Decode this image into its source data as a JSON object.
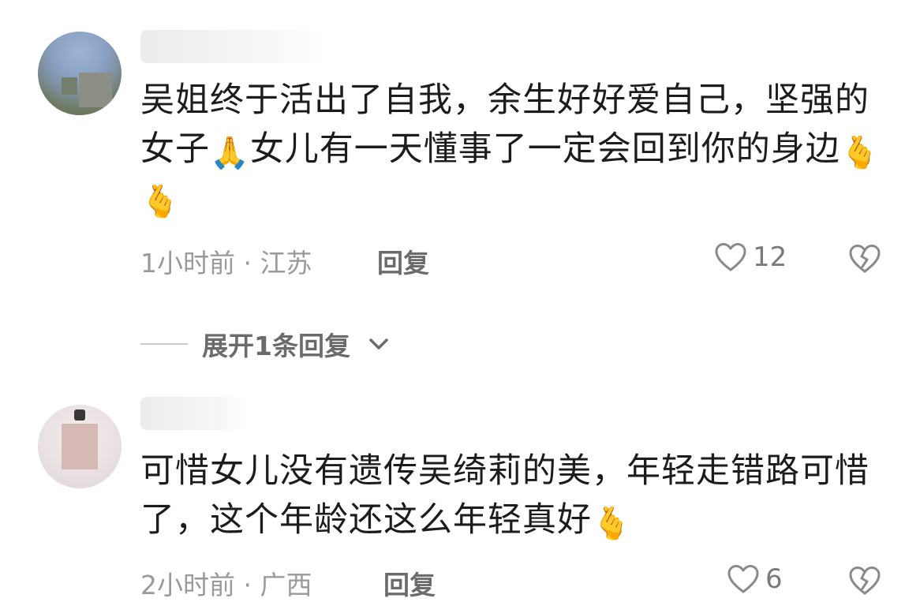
{
  "comments": [
    {
      "text_before": "吴姐终于活出了自我，余生好好爱自己，坚强的女子",
      "emoji_pray": "🙏",
      "text_after": "女儿有一天懂事了一定会回到你的身边",
      "emoji_heart1": "🫰",
      "emoji_heart2": "🫰",
      "meta": "1小时前 · 江苏",
      "reply_label": "回复",
      "likes": "12",
      "expand_label": "展开1条回复"
    },
    {
      "text_before": "可惜女儿没有遗传吴绮莉的美，年轻走错路可惜了，这个年龄还这么年轻真好",
      "emoji_heart": "🫰",
      "meta": "2小时前 · 广西",
      "reply_label": "回复",
      "likes": "6"
    }
  ],
  "colors": {
    "text": "#1c1c1c",
    "meta": "#9a9a9a",
    "reply": "#6b6b6b",
    "icon": "#8a8a8a"
  },
  "icons": [
    "heart-outline-icon",
    "broken-heart-icon",
    "chevron-down-icon",
    "pray-emoji",
    "finger-heart-emoji"
  ]
}
